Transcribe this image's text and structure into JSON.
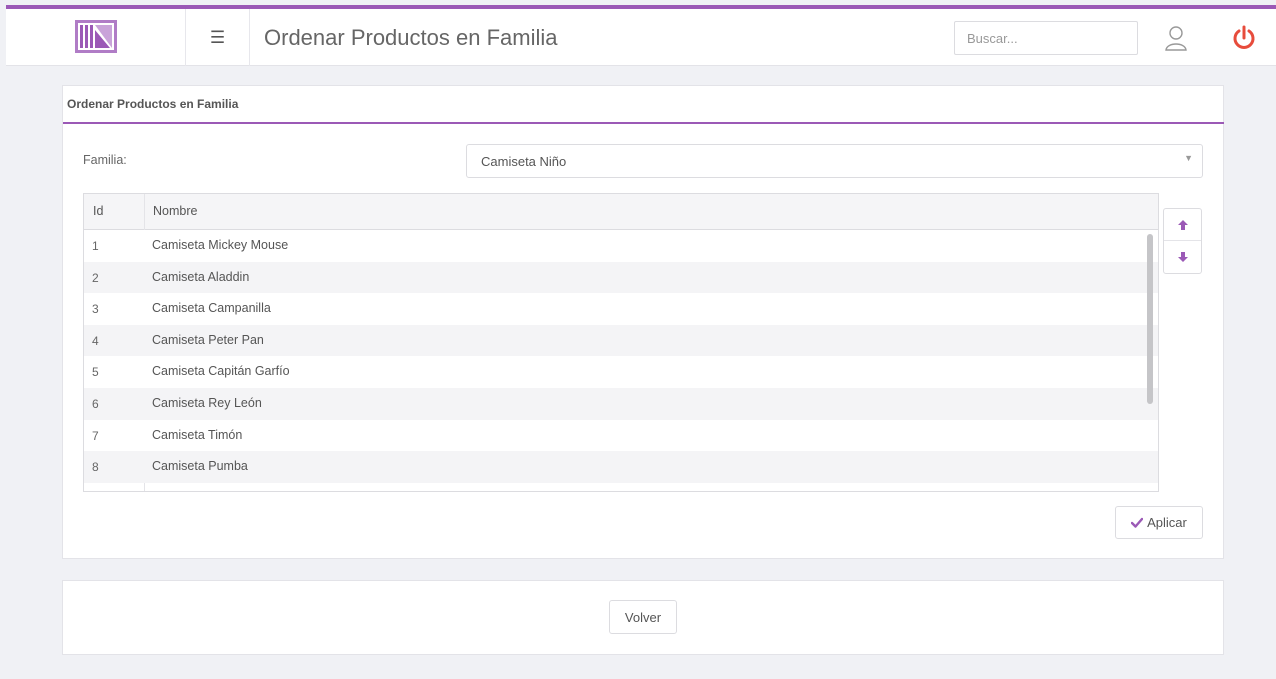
{
  "header": {
    "title": "Ordenar Productos en Familia",
    "menu_icon": "☰",
    "search_placeholder": "Buscar...",
    "search_value": ""
  },
  "panel": {
    "title": "Ordenar Productos en Familia",
    "familia_label": "Familia:",
    "familia_value": "Camiseta Niño",
    "table": {
      "columns": [
        "Id",
        "Nombre"
      ],
      "rows": [
        {
          "id": "1",
          "nombre": "Camiseta Mickey Mouse"
        },
        {
          "id": "2",
          "nombre": "Camiseta Aladdin"
        },
        {
          "id": "3",
          "nombre": "Camiseta Campanilla"
        },
        {
          "id": "4",
          "nombre": "Camiseta Peter Pan"
        },
        {
          "id": "5",
          "nombre": "Camiseta Capitán Garfío"
        },
        {
          "id": "6",
          "nombre": "Camiseta Rey León"
        },
        {
          "id": "7",
          "nombre": "Camiseta Timón"
        },
        {
          "id": "8",
          "nombre": "Camiseta Pumba"
        }
      ]
    },
    "apply_label": "Aplicar"
  },
  "footer": {
    "back_label": "Volver"
  },
  "icons": {
    "logo": "logo-icon",
    "menu": "hamburger-menu-icon",
    "user": "user-icon",
    "power": "power-icon",
    "up": "arrow-up-icon",
    "down": "arrow-down-icon",
    "check": "check-icon",
    "caret": "caret-down-icon"
  },
  "colors": {
    "accent": "#9b59b6",
    "power": "#e74c3c",
    "background": "#f0f1f5"
  }
}
